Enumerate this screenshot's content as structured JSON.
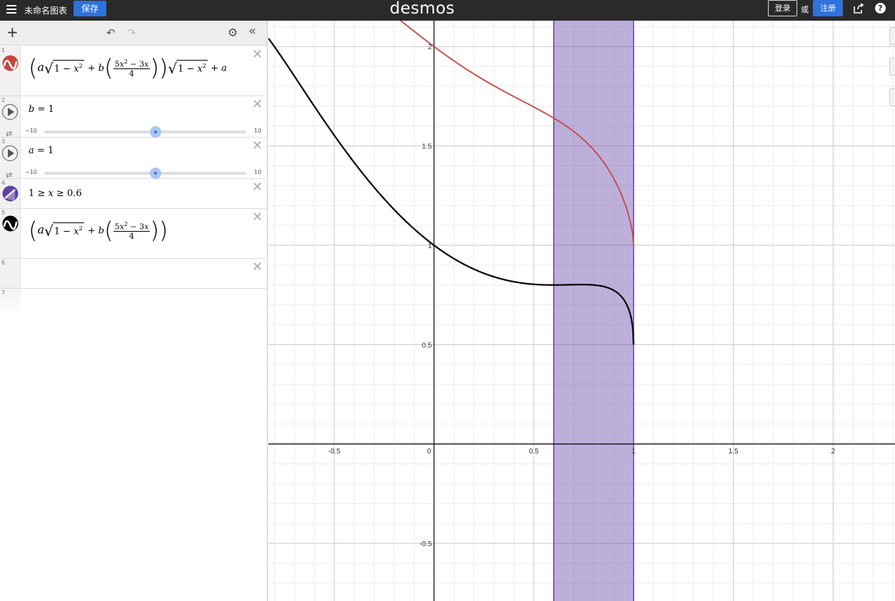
{
  "topbar": {
    "title": "未命名图表",
    "save_label": "保存",
    "brand": "desmos",
    "login_label": "登录",
    "or_label": "或",
    "register_label": "注册",
    "help_label": "?"
  },
  "panel": {
    "add_label": "+",
    "undo_label": "↶",
    "redo_label": "↷",
    "settings_label": "⚙",
    "collapse_label": "«",
    "expressions": [
      {
        "num": "1",
        "icon": "red-curve-icon",
        "color": "#c74440"
      },
      {
        "num": "2",
        "var": "b",
        "eq": " = ",
        "value": "1",
        "min": "−10",
        "max": "10",
        "fraction": 0.55
      },
      {
        "num": "3",
        "var": "a",
        "eq": " = ",
        "value": "1",
        "min": "−10",
        "max": "10",
        "fraction": 0.55
      },
      {
        "num": "4",
        "icon": "purple-region-icon",
        "color": "#6042a6",
        "lhs": "1 ≥ ",
        "mid": "x",
        "rhs": " ≥ 0.6"
      },
      {
        "num": "5",
        "icon": "black-curve-icon",
        "color": "#000000"
      },
      {
        "num": "6"
      },
      {
        "num": "7"
      }
    ],
    "delete_label": "✕"
  },
  "graph": {
    "x_ticks": [
      "-0.5",
      "0",
      "0.5",
      "1",
      "1.5",
      "2"
    ],
    "y_ticks": [
      "2",
      "1.5",
      "1",
      "0.5",
      "-0.5"
    ],
    "x_range": [
      -0.83,
      2.31
    ],
    "y_range": [
      -0.79,
      2.13
    ],
    "region": {
      "x_min": 0.6,
      "x_max": 1.0,
      "color": "#6042a6"
    },
    "curve_red": {
      "color": "#c74440",
      "formula": "(a√(1−x²) + b((5x²−3x)/4))√(1−x²) + a"
    },
    "curve_black": {
      "color": "#000000",
      "formula": "a√(1−x²) + b((5x²−3x)/4)"
    },
    "params": {
      "a": 1,
      "b": 1
    }
  }
}
